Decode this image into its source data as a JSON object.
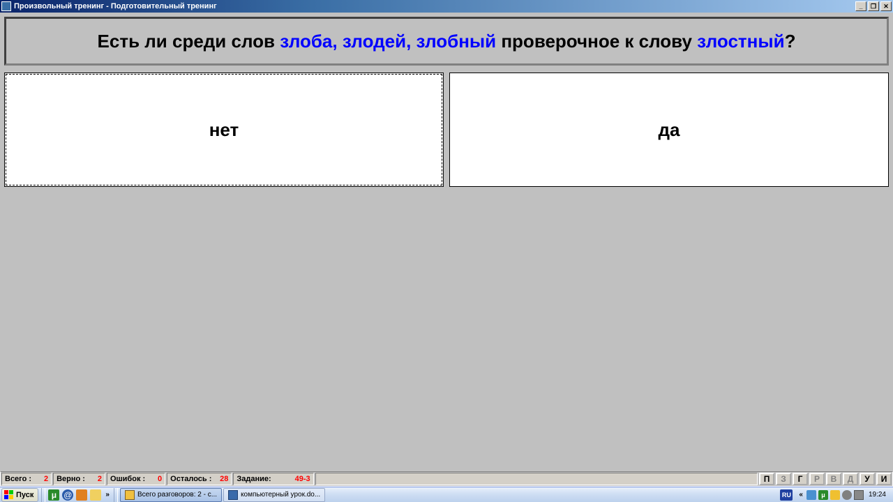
{
  "window": {
    "title": "Произвольный тренинг - Подготовительный тренинг"
  },
  "question": {
    "prefix": "Есть ли среди слов ",
    "highlight1": "злоба, злодей, злобный",
    "mid": " проверочное к слову ",
    "highlight2": "злостный",
    "suffix": "?"
  },
  "answers": {
    "left": "нет",
    "right": "да"
  },
  "status": {
    "total_label": "Всего :",
    "total_value": "2",
    "correct_label": "Верно :",
    "correct_value": "2",
    "errors_label": "Ошибок :",
    "errors_value": "0",
    "remain_label": "Осталось :",
    "remain_value": "28",
    "task_label": "Задание:",
    "task_value": "49-3"
  },
  "letter_buttons": [
    "П",
    "З",
    "Г",
    "Р",
    "В",
    "Д",
    "У",
    "И"
  ],
  "letter_disabled": [
    false,
    true,
    false,
    true,
    true,
    true,
    false,
    false
  ],
  "taskbar": {
    "start": "Пуск",
    "task1": "Всего разговоров: 2 - с...",
    "task2": "компьютерный урок.do...",
    "lang": "RU",
    "clock": "19:24"
  }
}
